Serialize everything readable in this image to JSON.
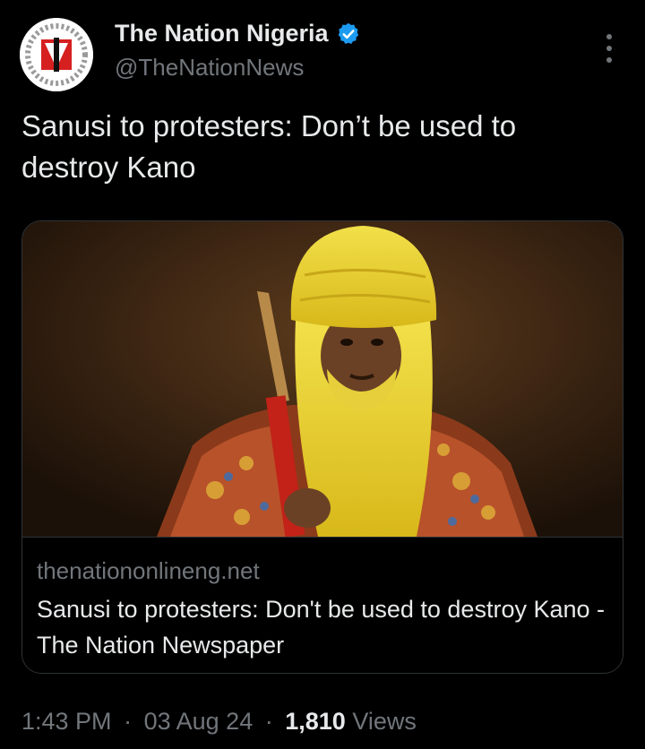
{
  "author": {
    "name": "The Nation Nigeria",
    "handle": "@TheNationNews",
    "verified_color": "#1d9bf0",
    "avatar_icon": "newspaper-logo-icon"
  },
  "tweet": {
    "text": "Sanusi to protesters: Don’t be used to destroy Kano"
  },
  "card": {
    "image_icon": "emir-portrait-image",
    "domain": "thenationonlineng.net",
    "title": "Sanusi to protesters: Don't be used to destroy Kano - The Nation Newspaper"
  },
  "meta": {
    "time": "1:43 PM",
    "separator": "·",
    "date": "03 Aug 24",
    "views_count": "1,810",
    "views_label": "Views"
  },
  "colors": {
    "background": "#000000",
    "text_primary": "#e7e9ea",
    "text_secondary": "#71767b",
    "border": "#2f3336",
    "accent": "#1d9bf0"
  }
}
